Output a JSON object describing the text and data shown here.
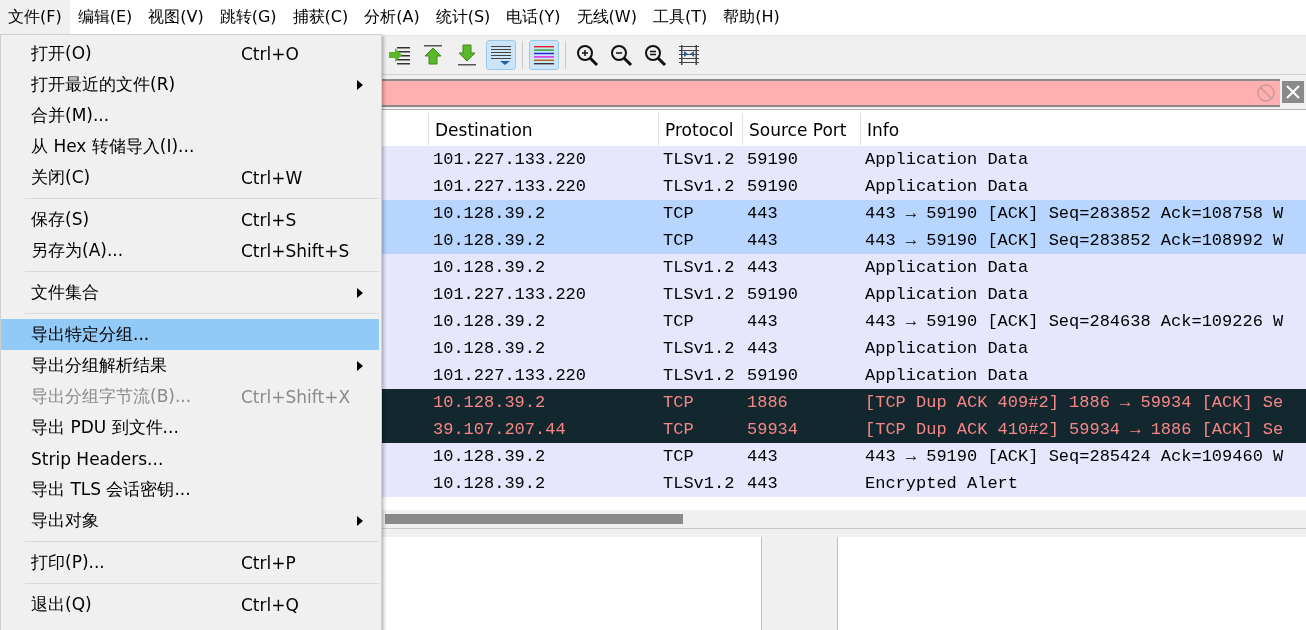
{
  "menubar": [
    {
      "label": "文件(F)",
      "selected": true
    },
    {
      "label": "编辑(E)",
      "selected": false
    },
    {
      "label": "视图(V)",
      "selected": false
    },
    {
      "label": "跳转(G)",
      "selected": false
    },
    {
      "label": "捕获(C)",
      "selected": false
    },
    {
      "label": "分析(A)",
      "selected": false
    },
    {
      "label": "统计(S)",
      "selected": false
    },
    {
      "label": "电话(Y)",
      "selected": false
    },
    {
      "label": "无线(W)",
      "selected": false
    },
    {
      "label": "工具(T)",
      "selected": false
    },
    {
      "label": "帮助(H)",
      "selected": false
    }
  ],
  "file_menu": [
    {
      "kind": "item",
      "label": "打开(O)",
      "shortcut": "Ctrl+O",
      "submenu": false,
      "disabled": false,
      "selected": false
    },
    {
      "kind": "item",
      "label": "打开最近的文件(R)",
      "submenu": true,
      "disabled": false,
      "selected": false
    },
    {
      "kind": "item",
      "label": "合并(M)...",
      "submenu": false,
      "disabled": false,
      "selected": false
    },
    {
      "kind": "item",
      "label": "从 Hex 转储导入(I)...",
      "submenu": false,
      "disabled": false,
      "selected": false
    },
    {
      "kind": "item",
      "label": "关闭(C)",
      "shortcut": "Ctrl+W",
      "submenu": false,
      "disabled": false,
      "selected": false
    },
    {
      "kind": "separator"
    },
    {
      "kind": "item",
      "label": "保存(S)",
      "shortcut": "Ctrl+S",
      "submenu": false,
      "disabled": false,
      "selected": false
    },
    {
      "kind": "item",
      "label": "另存为(A)...",
      "shortcut": "Ctrl+Shift+S",
      "submenu": false,
      "disabled": false,
      "selected": false
    },
    {
      "kind": "separator"
    },
    {
      "kind": "item",
      "label": "文件集合",
      "submenu": true,
      "disabled": false,
      "selected": false
    },
    {
      "kind": "separator"
    },
    {
      "kind": "item",
      "label": "导出特定分组...",
      "submenu": false,
      "disabled": false,
      "selected": true
    },
    {
      "kind": "item",
      "label": "导出分组解析结果",
      "submenu": true,
      "disabled": false,
      "selected": false
    },
    {
      "kind": "item",
      "label": "导出分组字节流(B)...",
      "shortcut": "Ctrl+Shift+X",
      "submenu": false,
      "disabled": true,
      "selected": false
    },
    {
      "kind": "item",
      "label": "导出 PDU 到文件...",
      "submenu": false,
      "disabled": false,
      "selected": false
    },
    {
      "kind": "item",
      "label": "Strip Headers...",
      "submenu": false,
      "disabled": false,
      "selected": false
    },
    {
      "kind": "item",
      "label": "导出 TLS 会话密钥...",
      "submenu": false,
      "disabled": false,
      "selected": false
    },
    {
      "kind": "item",
      "label": "导出对象",
      "submenu": true,
      "disabled": false,
      "selected": false
    },
    {
      "kind": "separator"
    },
    {
      "kind": "item",
      "label": "打印(P)...",
      "shortcut": "Ctrl+P",
      "submenu": false,
      "disabled": false,
      "selected": false
    },
    {
      "kind": "separator"
    },
    {
      "kind": "item",
      "label": "退出(Q)",
      "shortcut": "Ctrl+Q",
      "submenu": false,
      "disabled": false,
      "selected": false
    }
  ],
  "toolbar": [
    {
      "kind": "jump",
      "pressed": false
    },
    {
      "kind": "first",
      "pressed": false
    },
    {
      "kind": "last",
      "pressed": false
    },
    {
      "kind": "autoscroll",
      "pressed": true
    },
    {
      "kind": "separator"
    },
    {
      "kind": "colorize",
      "pressed": true
    },
    {
      "kind": "separator"
    },
    {
      "kind": "zoom-in",
      "pressed": false
    },
    {
      "kind": "zoom-out",
      "pressed": false
    },
    {
      "kind": "zoom-reset",
      "pressed": false
    },
    {
      "kind": "resize-columns",
      "pressed": false
    }
  ],
  "filter": {
    "invalid": true
  },
  "packet_list": {
    "columns": [
      "Destination",
      "Protocol",
      "Source Port",
      "Info"
    ],
    "rows": [
      {
        "kind": "normal",
        "selected": false,
        "cells": [
          "101.227.133.220",
          "TLSv1.2",
          "59190",
          "Application Data"
        ]
      },
      {
        "kind": "normal",
        "selected": false,
        "cells": [
          "101.227.133.220",
          "TLSv1.2",
          "59190",
          "Application Data"
        ]
      },
      {
        "kind": "normal",
        "selected": true,
        "cells": [
          "10.128.39.2",
          "TCP",
          "443",
          "443 → 59190 [ACK] Seq=283852 Ack=108758 W"
        ]
      },
      {
        "kind": "normal",
        "selected": true,
        "cells": [
          "10.128.39.2",
          "TCP",
          "443",
          "443 → 59190 [ACK] Seq=283852 Ack=108992 W"
        ]
      },
      {
        "kind": "normal",
        "selected": false,
        "cells": [
          "10.128.39.2",
          "TLSv1.2",
          "443",
          "Application Data"
        ]
      },
      {
        "kind": "normal",
        "selected": false,
        "cells": [
          "101.227.133.220",
          "TLSv1.2",
          "59190",
          "Application Data"
        ]
      },
      {
        "kind": "normal",
        "selected": false,
        "cells": [
          "10.128.39.2",
          "TCP",
          "443",
          "443 → 59190 [ACK] Seq=284638 Ack=109226 W"
        ]
      },
      {
        "kind": "normal",
        "selected": false,
        "cells": [
          "10.128.39.2",
          "TLSv1.2",
          "443",
          "Application Data"
        ]
      },
      {
        "kind": "normal",
        "selected": false,
        "cells": [
          "101.227.133.220",
          "TLSv1.2",
          "59190",
          "Application Data"
        ]
      },
      {
        "kind": "error",
        "selected": false,
        "cells": [
          "10.128.39.2",
          "TCP",
          "1886",
          "[TCP Dup ACK 409#2] 1886 → 59934 [ACK] Se"
        ]
      },
      {
        "kind": "error",
        "selected": false,
        "cells": [
          "39.107.207.44",
          "TCP",
          "59934",
          "[TCP Dup ACK 410#2] 59934 → 1886 [ACK] Se"
        ]
      },
      {
        "kind": "normal",
        "selected": false,
        "cells": [
          "10.128.39.2",
          "TCP",
          "443",
          "443 → 59190 [ACK] Seq=285424 Ack=109460 W"
        ]
      },
      {
        "kind": "normal",
        "selected": false,
        "cells": [
          "10.128.39.2",
          "TLSv1.2",
          "443",
          "Encrypted Alert"
        ]
      }
    ]
  }
}
